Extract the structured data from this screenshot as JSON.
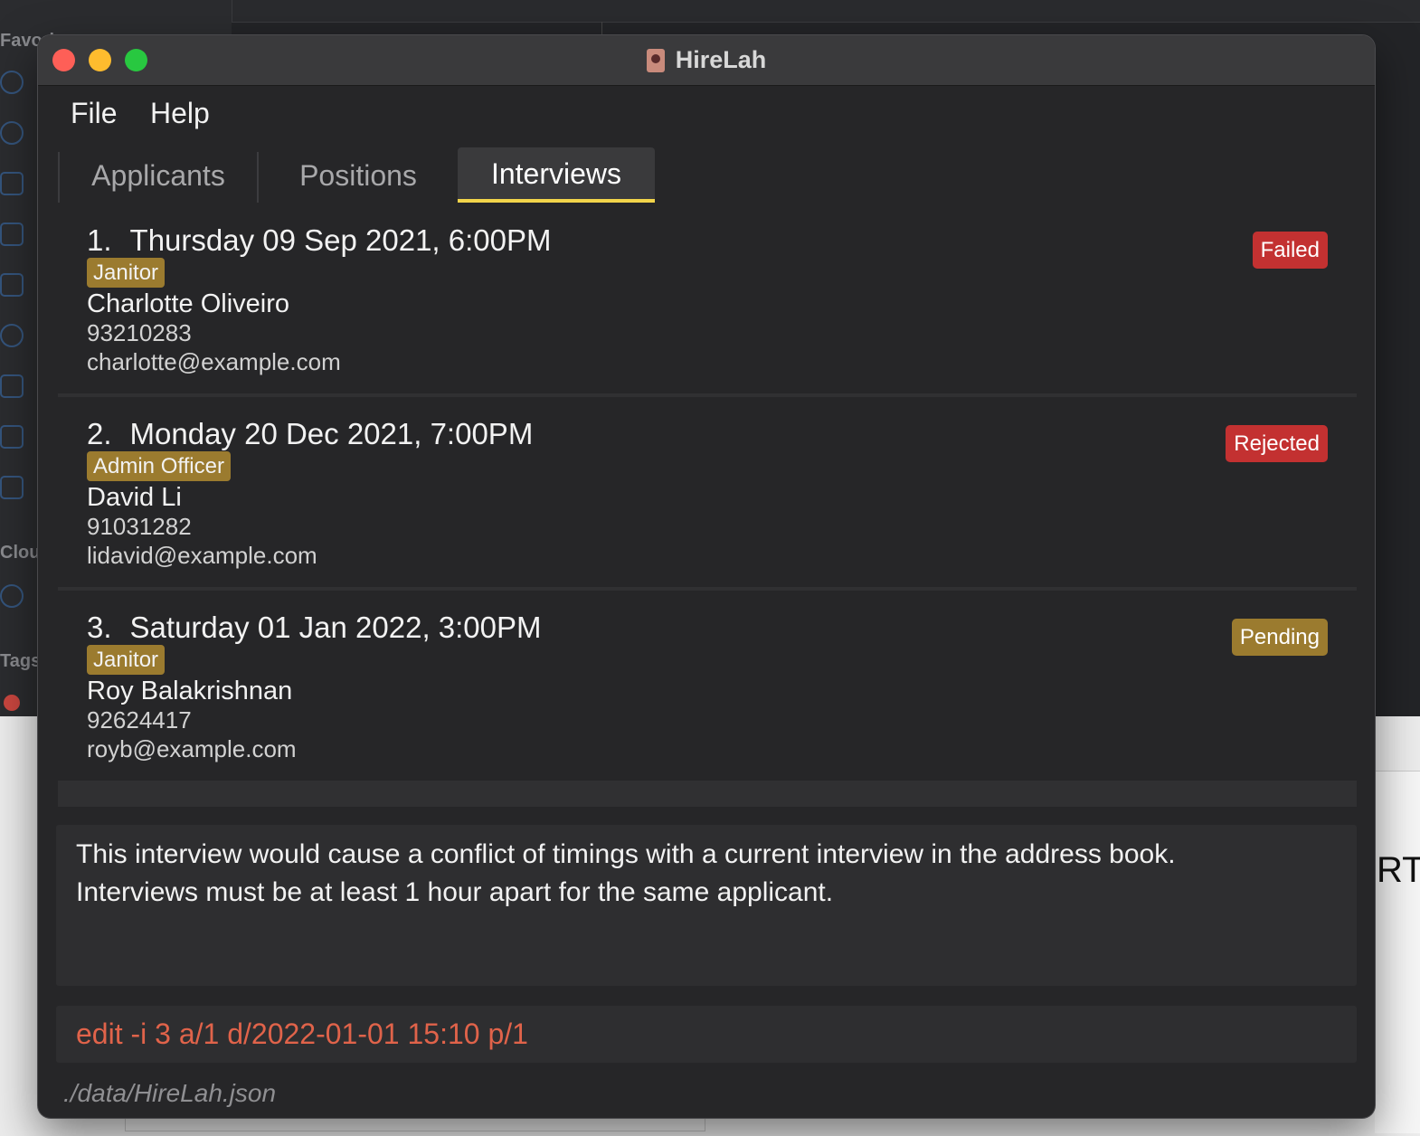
{
  "window": {
    "title": "HireLah"
  },
  "background": {
    "sidebar_labels": [
      "Favori",
      "Clou",
      "Tags"
    ],
    "right_text": "RT_"
  },
  "menu": {
    "file": "File",
    "help": "Help"
  },
  "tabs": [
    {
      "label": "Applicants",
      "selected": false
    },
    {
      "label": "Positions",
      "selected": false
    },
    {
      "label": "Interviews",
      "selected": true
    }
  ],
  "interviews": [
    {
      "index": "1.",
      "datetime": "Thursday 09 Sep 2021, 6:00PM",
      "position": "Janitor",
      "name": "Charlotte Oliveiro",
      "phone": "93210283",
      "email": "charlotte@example.com",
      "status": "Failed"
    },
    {
      "index": "2.",
      "datetime": "Monday 20 Dec 2021, 7:00PM",
      "position": "Admin Officer",
      "name": "David Li",
      "phone": "91031282",
      "email": "lidavid@example.com",
      "status": "Rejected"
    },
    {
      "index": "3.",
      "datetime": "Saturday 01 Jan 2022, 3:00PM",
      "position": "Janitor",
      "name": "Roy Balakrishnan",
      "phone": "92624417",
      "email": "royb@example.com",
      "status": "Pending"
    }
  ],
  "result": {
    "line1": "This interview would cause a conflict of timings with a current interview in the address book.",
    "line2": "Interviews must be at least 1 hour apart for the same applicant."
  },
  "command": {
    "value": "edit -i 3 a/1 d/2022-01-01 15:10 p/1"
  },
  "status_bar": {
    "path": "./data/HireLah.json"
  },
  "colors": {
    "tab_highlight": "#f2d44a",
    "position_tag": "#9b7b2f",
    "status_failed": "#c33131",
    "status_rejected": "#c33131",
    "status_pending": "#9b7b2f",
    "command_error": "#e0634a"
  }
}
